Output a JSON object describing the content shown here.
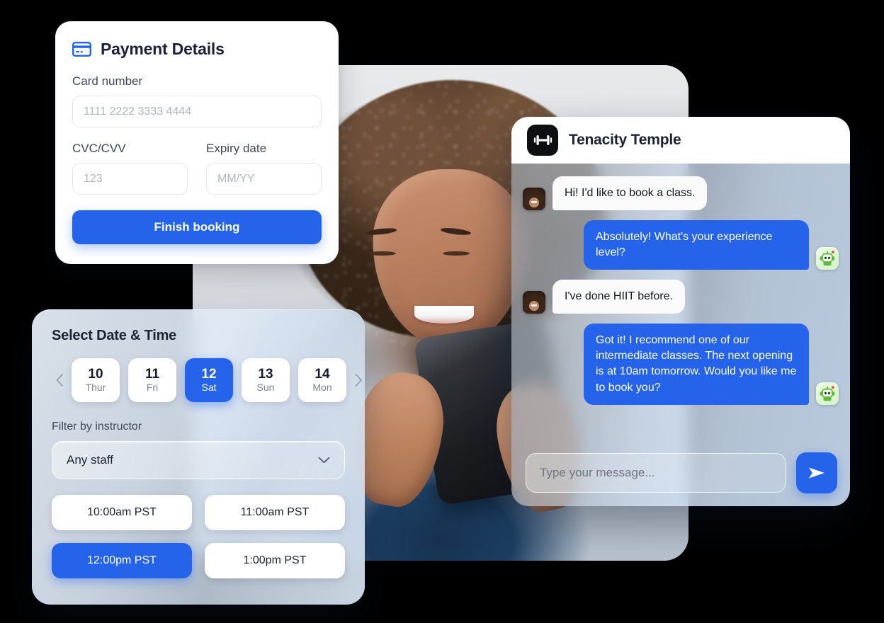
{
  "payment": {
    "icon": "credit-card-icon",
    "title": "Payment Details",
    "card_number_label": "Card number",
    "card_number_placeholder": "1111 2222 3333 4444",
    "cvc_label": "CVC/CVV",
    "cvc_placeholder": "123",
    "expiry_label": "Expiry date",
    "expiry_placeholder": "MM/YY",
    "submit_label": "Finish booking"
  },
  "booking": {
    "title": "Select Date & Time",
    "prev_icon": "chevron-left-icon",
    "next_icon": "chevron-right-icon",
    "dates": [
      {
        "day": "10",
        "dow": "Thur",
        "selected": false
      },
      {
        "day": "11",
        "dow": "Fri",
        "selected": false
      },
      {
        "day": "12",
        "dow": "Sat",
        "selected": true
      },
      {
        "day": "13",
        "dow": "Sun",
        "selected": false
      },
      {
        "day": "14",
        "dow": "Mon",
        "selected": false
      }
    ],
    "filter_label": "Filter by instructor",
    "filter_value": "Any staff",
    "filter_chevron": "chevron-down-icon",
    "slots": [
      {
        "time": "10:00am PST",
        "selected": false
      },
      {
        "time": "11:00am PST",
        "selected": false
      },
      {
        "time": "12:00pm PST",
        "selected": true
      },
      {
        "time": "1:00pm PST",
        "selected": false
      }
    ]
  },
  "chat": {
    "brand_name": "Tenacity Temple",
    "brand_logo_icon": "dumbbell-icon",
    "user_avatar_icon": "user-avatar",
    "bot_avatar_icon": "robot-avatar",
    "messages": [
      {
        "from": "user",
        "text": "Hi! I'd like to book a class."
      },
      {
        "from": "bot",
        "text": "Absolutely! What's your experience level?"
      },
      {
        "from": "user",
        "text": "I've done HIIT before."
      },
      {
        "from": "bot",
        "text": "Got it! I recommend one of our intermediate classes. The next opening is at 10am tomorrow. Would you like me to book you?"
      }
    ],
    "input_placeholder": "Type your message...",
    "send_icon": "send-icon"
  },
  "colors": {
    "accent_blue": "#2563EB",
    "text_dark": "#1B2236",
    "placeholder": "#B0B5BE",
    "logo_black": "#0D0F12",
    "bot_avatar_green": "#6CC24A"
  }
}
